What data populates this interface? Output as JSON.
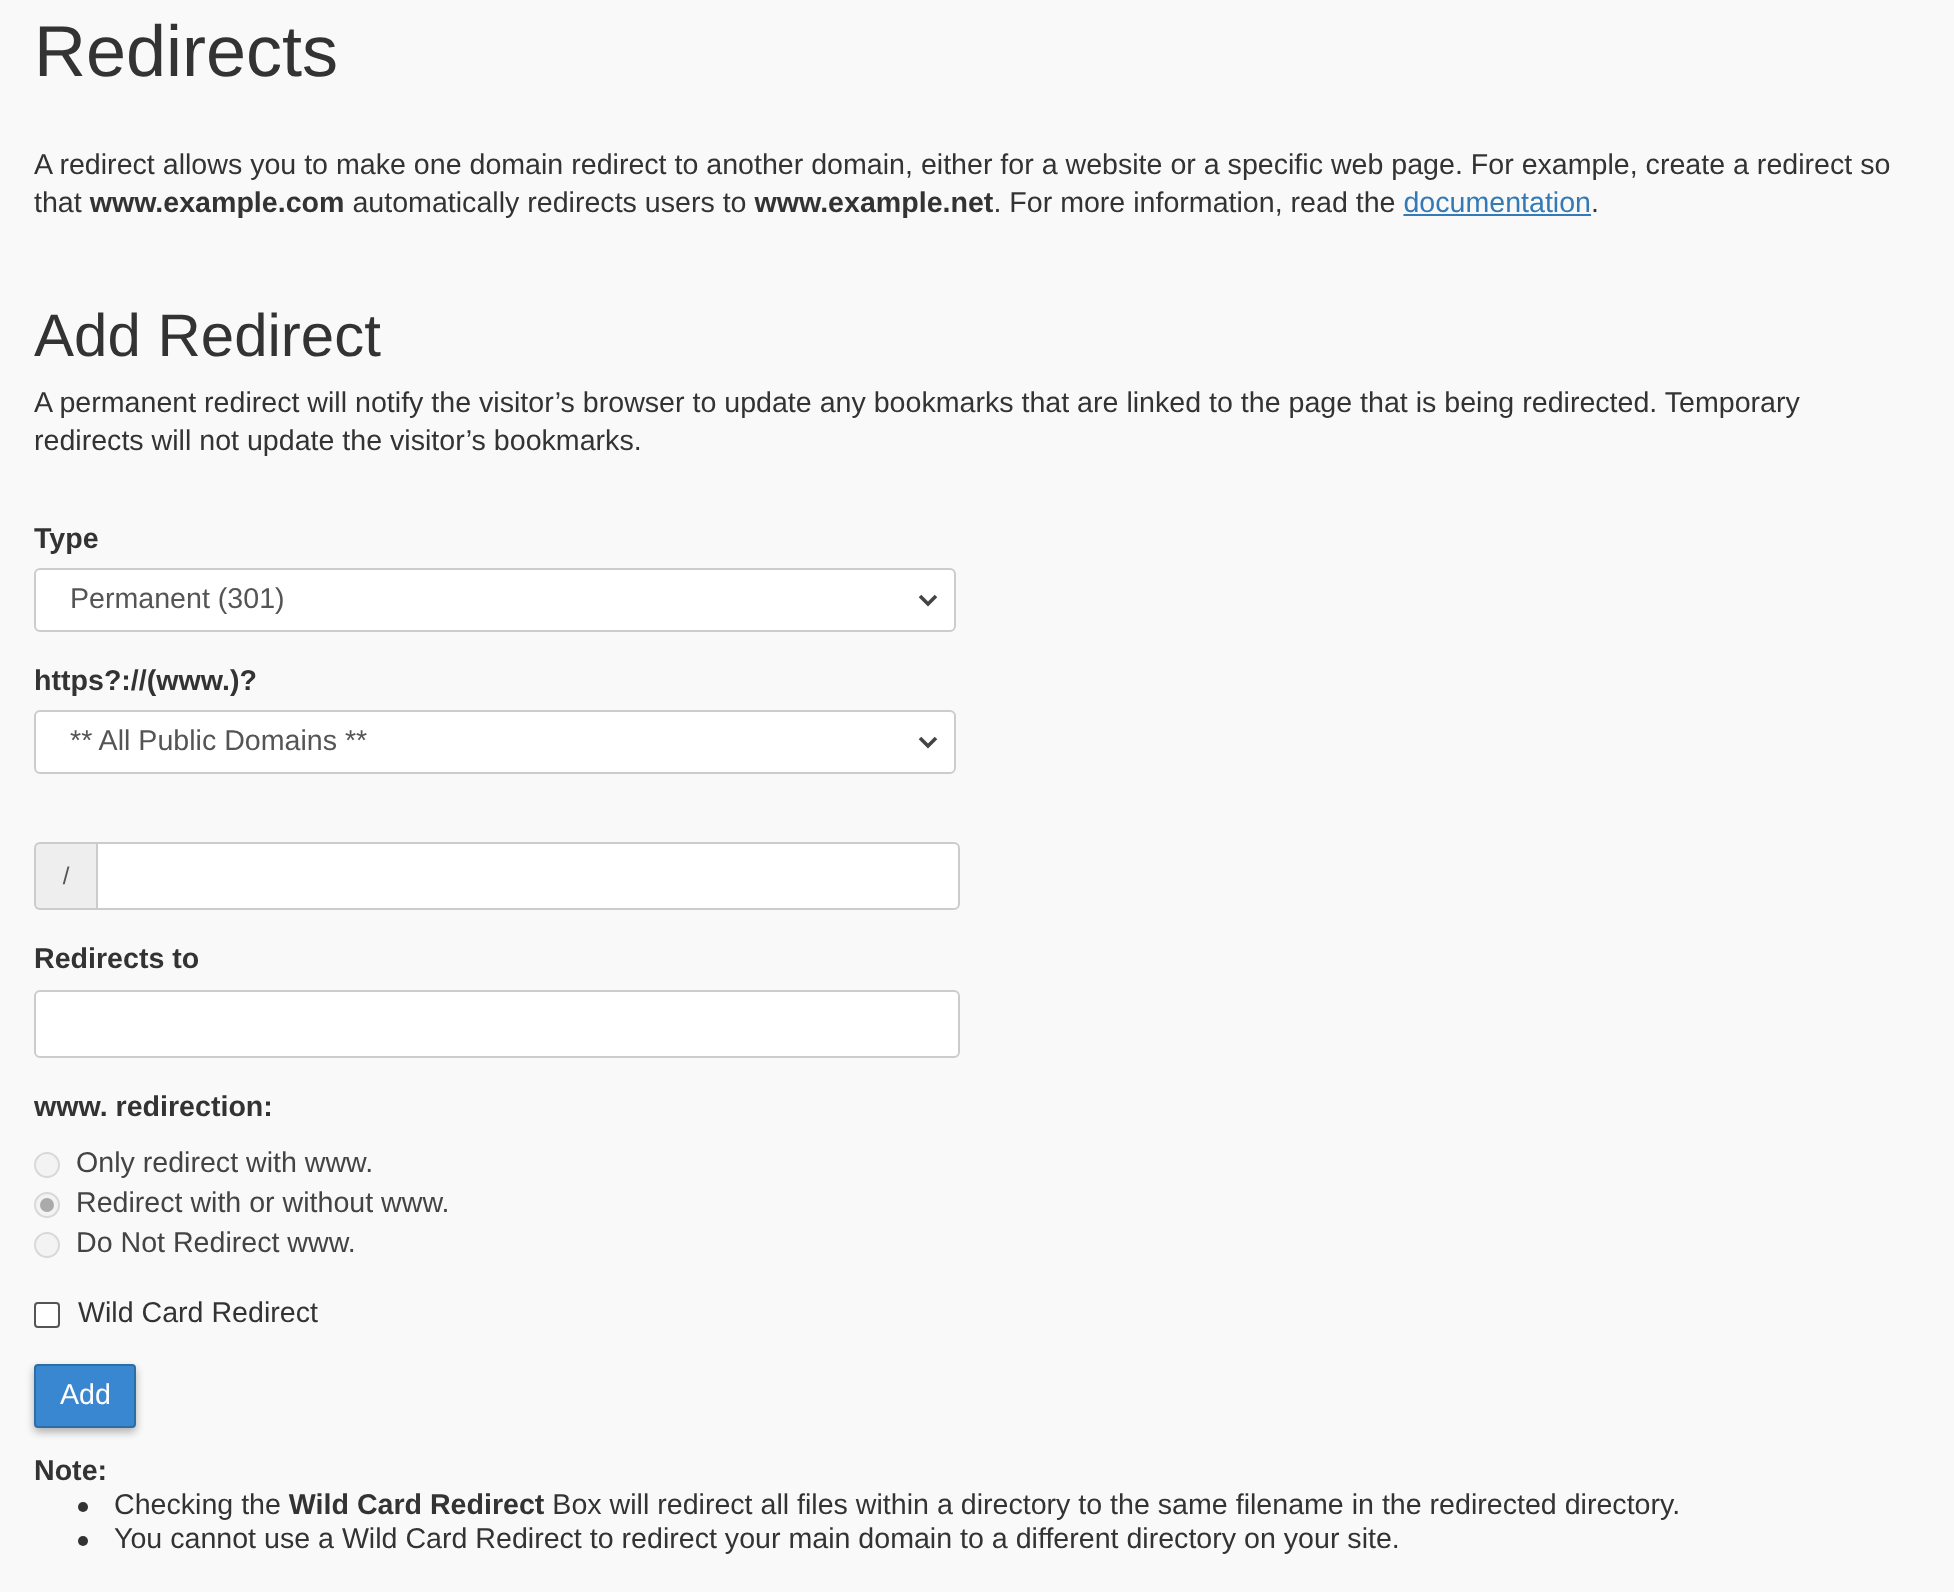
{
  "title": "Redirects",
  "intro": {
    "text": "A redirect allows you to make one domain redirect to another domain, either for a website or a specific web page. For example, create a redirect so that **www.example.com** automatically redirects users to **www.example.net**. For more information, read the ",
    "link": "documentation",
    "after": "."
  },
  "section": {
    "title": "Add Redirect",
    "description": "A permanent redirect will notify the visitor’s browser to update any bookmarks that are linked to the page that is being redirected. Temporary redirects will not update the visitor’s bookmarks."
  },
  "type_field": {
    "label": "Type",
    "value": "Permanent (301)"
  },
  "domain_field": {
    "label": "https?://(www.)?",
    "value": "** All Public Domains **"
  },
  "path_field": {
    "prefix": "/"
  },
  "redirects_to": {
    "label": "Redirects to"
  },
  "www_redirection": {
    "label": "www. redirection:",
    "options": [
      {
        "label": "Only redirect with www.",
        "selected": false,
        "disabled": true
      },
      {
        "label": "Redirect with or without www.",
        "selected": true,
        "disabled": true
      },
      {
        "label": "Do Not Redirect www.",
        "selected": false,
        "disabled": true
      }
    ]
  },
  "wildcard": {
    "label": "Wild Card Redirect",
    "checked": false
  },
  "add_button": "Add",
  "note": {
    "title": "Note:",
    "items": [
      "Checking the **Wild Card Redirect** Box will redirect all files within a directory to the same filename in the redirected directory.",
      "You cannot use a Wild Card Redirect to redirect your main domain to a different directory on your site."
    ]
  }
}
